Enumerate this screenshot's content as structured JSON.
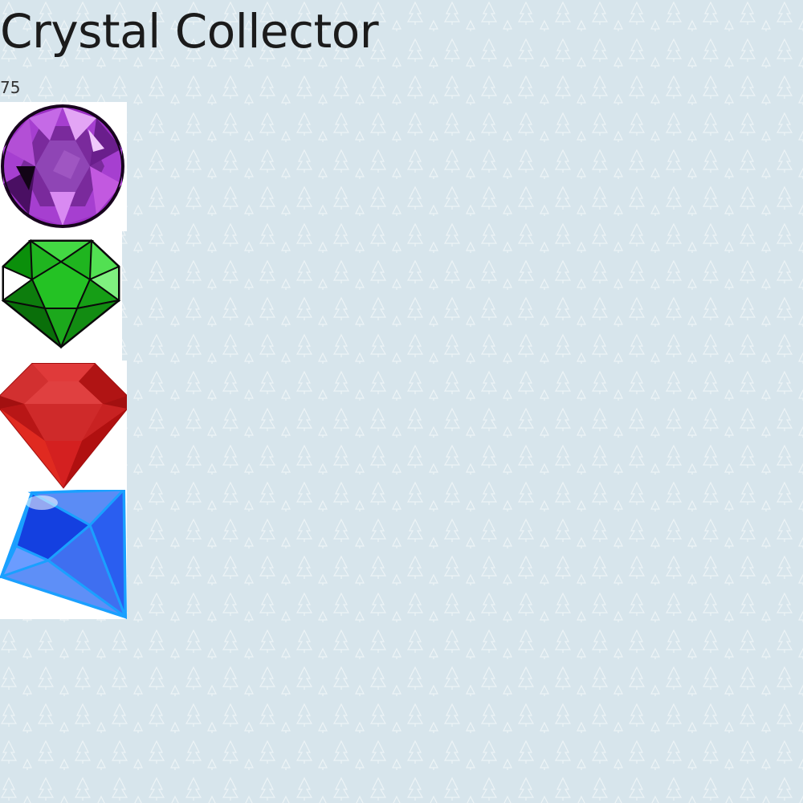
{
  "title": "Crystal Collector",
  "score": "75",
  "crystals": [
    {
      "name": "purple-crystal",
      "color": "#9b2fc4"
    },
    {
      "name": "green-crystal",
      "color": "#22b622"
    },
    {
      "name": "red-crystal",
      "color": "#cc2020"
    },
    {
      "name": "blue-crystal",
      "color": "#2b5cf0"
    }
  ]
}
